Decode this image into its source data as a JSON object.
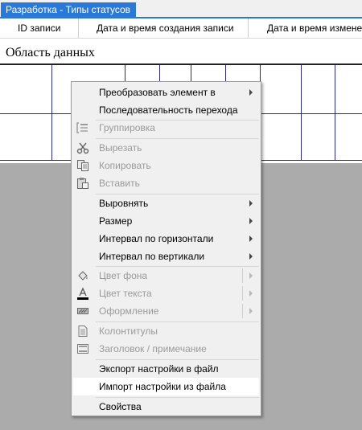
{
  "window": {
    "tab_title": "Разработка - Типы статусов"
  },
  "columns": [
    "ID записи",
    "Дата и время создания записи",
    "Дата и время изменен"
  ],
  "data_area": {
    "title": "Область данных"
  },
  "context_menu": {
    "items": [
      {
        "label": "Преобразовать элемент в",
        "enabled": true,
        "submenu": true
      },
      {
        "label": "Последовательность перехода",
        "enabled": true,
        "submenu": false
      },
      {
        "label": "Группировка",
        "enabled": false,
        "icon": "grouping-icon"
      },
      {
        "label": "Вырезать",
        "enabled": false,
        "icon": "scissors-icon"
      },
      {
        "label": "Копировать",
        "enabled": false,
        "icon": "copy-icon"
      },
      {
        "label": "Вставить",
        "enabled": false,
        "icon": "paste-icon"
      },
      {
        "label": "Выровнять",
        "enabled": true,
        "submenu": true
      },
      {
        "label": "Размер",
        "enabled": true,
        "submenu": true
      },
      {
        "label": "Интервал по горизонтали",
        "enabled": true,
        "submenu": true
      },
      {
        "label": "Интервал по вертикали",
        "enabled": true,
        "submenu": true
      },
      {
        "label": "Цвет фона",
        "enabled": false,
        "submenu": true,
        "icon": "fill-color-icon"
      },
      {
        "label": "Цвет текста",
        "enabled": false,
        "submenu": true,
        "icon": "font-color-icon"
      },
      {
        "label": "Оформление",
        "enabled": false,
        "submenu": true,
        "icon": "special-effect-icon"
      },
      {
        "label": "Колонтитулы",
        "enabled": false,
        "icon": "page-header-footer-icon"
      },
      {
        "label": "Заголовок / примечание",
        "enabled": false,
        "icon": "report-header-footer-icon"
      },
      {
        "label": "Экспорт настройки в файл",
        "enabled": true
      },
      {
        "label": "Импорт настройки из файла",
        "enabled": true,
        "highlighted": true
      },
      {
        "label": "Свойства",
        "enabled": true
      }
    ]
  },
  "colors": {
    "tab_accent": "#2b79d6",
    "grid": "#2a2a8a",
    "menu_bg": "#f0f0f0",
    "disabled_text": "#9a9a9a",
    "workspace": "#ababab"
  }
}
